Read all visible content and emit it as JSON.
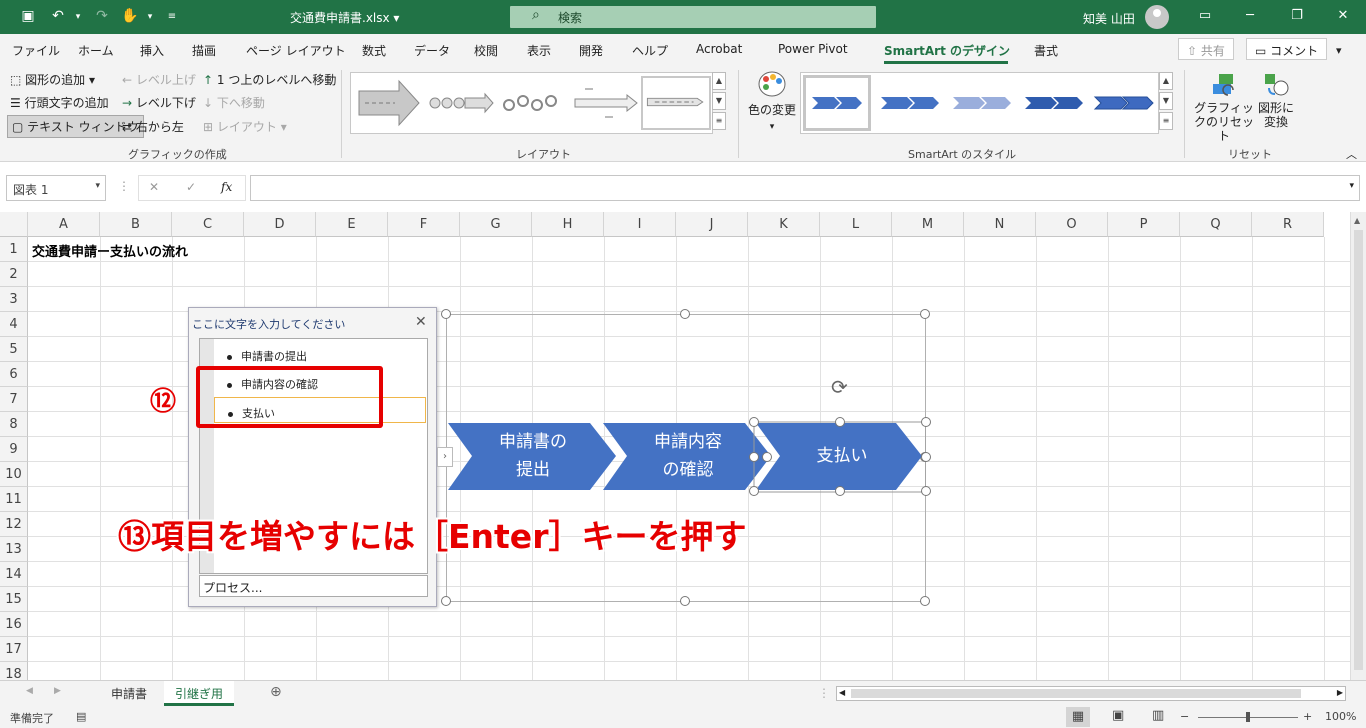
{
  "title_bar": {
    "doc_title": "交通費申請書.xlsx ▾",
    "search_placeholder": "検索",
    "user_name": "知美 山田"
  },
  "menu": {
    "tabs": [
      "ファイル",
      "ホーム",
      "挿入",
      "描画",
      "ページ レイアウト",
      "数式",
      "データ",
      "校閲",
      "表示",
      "開発",
      "ヘルプ",
      "Acrobat",
      "Power Pivot",
      "SmartArt のデザイン",
      "書式"
    ],
    "active_tab": "SmartArt のデザイン",
    "share_label": "共有",
    "comment_label": "コメント"
  },
  "ribbon": {
    "create_graphic": {
      "add_shape": "図形の追加",
      "add_bullet": "行頭文字の追加",
      "text_pane": "テキスト ウィンドウ",
      "promote": "レベル上げ",
      "demote": "レベル下げ",
      "right_to_left": "右から左",
      "move_up": "1 つ上のレベルへ移動",
      "move_down": "下へ移動",
      "layout": "レイアウト",
      "group_label": "グラフィックの作成"
    },
    "layouts_group_label": "レイアウト",
    "change_colors": "色の変更",
    "styles_group_label": "SmartArt のスタイル",
    "reset_graphic": "グラフィックのリセット",
    "convert_to_shapes": "図形に変換",
    "reset_group_label": "リセット"
  },
  "formula_bar": {
    "name_box": "図表 1",
    "fx": "fx",
    "formula": ""
  },
  "sheet": {
    "columns": [
      "A",
      "B",
      "C",
      "D",
      "E",
      "F",
      "G",
      "H",
      "I",
      "J",
      "K",
      "L",
      "M",
      "N",
      "O",
      "P",
      "Q",
      "R"
    ],
    "rows": [
      "1",
      "2",
      "3",
      "4",
      "5",
      "6",
      "7",
      "8",
      "9",
      "10",
      "11",
      "12",
      "13",
      "14",
      "15",
      "16",
      "17",
      "18"
    ],
    "a1": "交通費申請ー支払いの流れ"
  },
  "text_pane": {
    "title": "ここに文字を入力してください",
    "items": [
      "申請書の提出",
      "申請内容の確認",
      "支払い"
    ],
    "footer": "プロセス..."
  },
  "smartart": {
    "shape1_line1": "申請書の",
    "shape1_line2": "提出",
    "shape2_line1": "申請内容",
    "shape2_line2": "の確認",
    "shape3": "支払い",
    "fill_color": "#4472c4"
  },
  "annotations": {
    "step12": "⑫",
    "step13": "⑬項目を増やすには［Enter］キーを押す",
    "color": "#e60000"
  },
  "sheet_tabs": {
    "tabs": [
      "申請書",
      "引継ぎ用"
    ],
    "active": "引継ぎ用"
  },
  "status_bar": {
    "ready": "準備完了",
    "zoom": "100%"
  }
}
